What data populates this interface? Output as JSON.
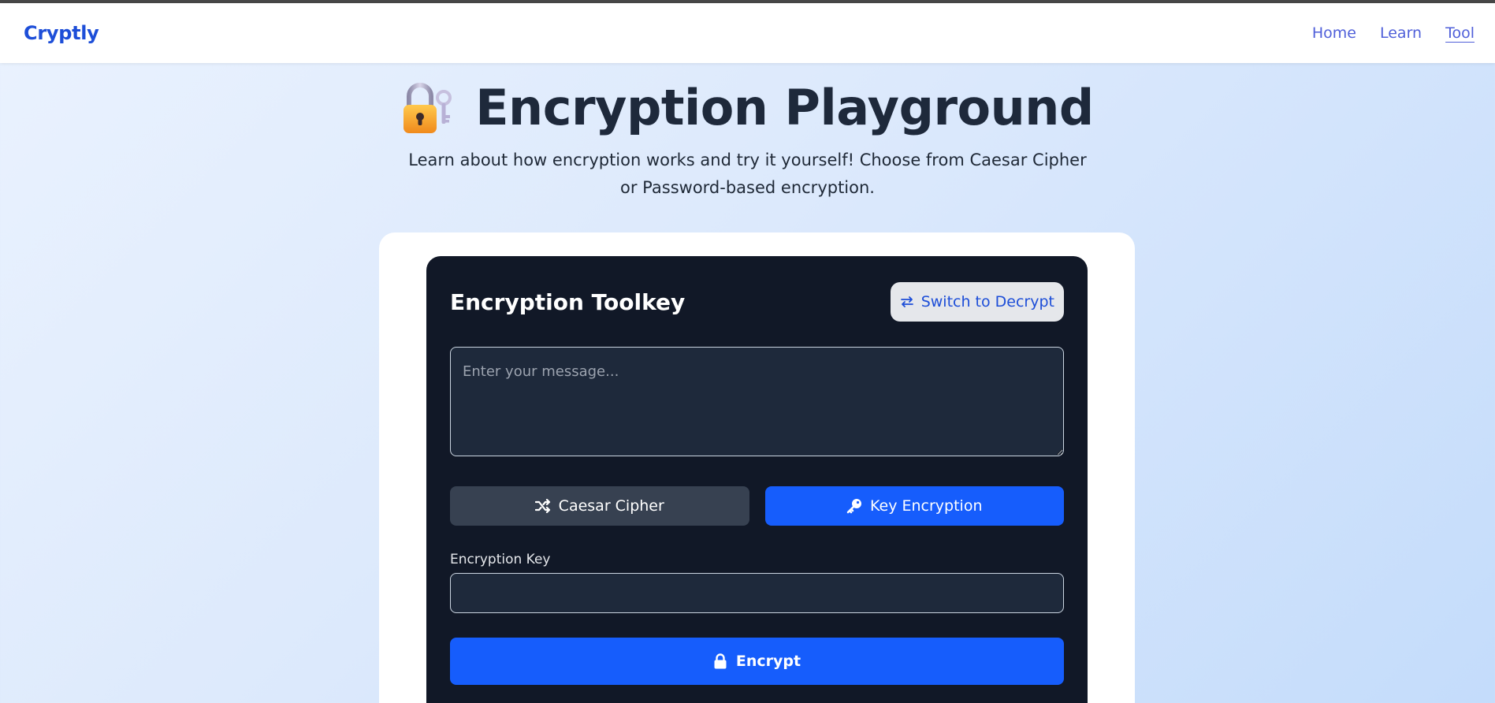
{
  "nav": {
    "brand": "Cryptly",
    "links": [
      {
        "label": "Home",
        "active": false
      },
      {
        "label": "Learn",
        "active": false
      },
      {
        "label": "Tool",
        "active": true
      }
    ],
    "brand_color": "#1d4ed8",
    "link_color": "#4f5fd9"
  },
  "hero": {
    "icon": "lock-with-key-icon",
    "title": "Encryption Playground",
    "subtitle": "Learn about how encryption works and try it yourself! Choose from Caesar Cipher or Password-based encryption."
  },
  "toolkit": {
    "title": "Encryption Toolkey",
    "switch_label": "Switch to Decrypt",
    "switch_icon": "swap-arrows-icon",
    "message_placeholder": "Enter your message...",
    "message_value": "",
    "methods": [
      {
        "label": "Caesar Cipher",
        "icon": "shuffle-icon",
        "selected": false
      },
      {
        "label": "Key Encryption",
        "icon": "key-icon",
        "selected": true
      }
    ],
    "key_label": "Encryption Key",
    "key_value": "",
    "encrypt_label": "Encrypt",
    "encrypt_icon": "lock-icon"
  },
  "colors": {
    "accent": "#165dfc",
    "card_bg": "#111827",
    "field_bg": "#1e293b",
    "unselected_method_bg": "#374151"
  }
}
